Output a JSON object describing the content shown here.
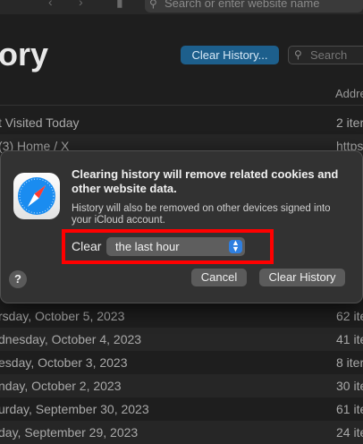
{
  "toolbar": {
    "search_placeholder": "Search or enter website name",
    "back_icon": "chevron-left-icon",
    "forward_icon": "chevron-right-icon",
    "shield_icon": "privacy-shield-icon"
  },
  "history": {
    "title": "ory",
    "clear_button_label": "Clear History...",
    "search_placeholder": "Search",
    "address_column_header": "Addre",
    "rows": [
      {
        "title": "t Visited Today",
        "addr": "2 iter"
      },
      {
        "title": "(3) Home / X",
        "addr": "https"
      },
      {
        "title": "rsday, October 5, 2023",
        "addr": "62 ite"
      },
      {
        "title": "dnesday, October 4, 2023",
        "addr": "41 ite"
      },
      {
        "title": "esday, October 3, 2023",
        "addr": "8 iter"
      },
      {
        "title": "nday, October 2, 2023",
        "addr": "30 ite"
      },
      {
        "title": "urday, September 30, 2023",
        "addr": "61 ite"
      },
      {
        "title": "day, September 29, 2023",
        "addr": "24 ite"
      }
    ]
  },
  "dialog": {
    "title": "Clearing history will remove related cookies and other website data.",
    "subtitle": "History will also be removed on other devices signed into your iCloud account.",
    "clear_label": "Clear",
    "selected_range": "the last hour",
    "cancel_label": "Cancel",
    "confirm_label": "Clear History",
    "help_label": "?",
    "app_icon": "safari-compass-icon",
    "highlight_color": "#ff0000"
  },
  "colors": {
    "accent": "#2f7fe0",
    "clear_history_top": "#1d5f8c",
    "background": "#1e1e1e"
  }
}
